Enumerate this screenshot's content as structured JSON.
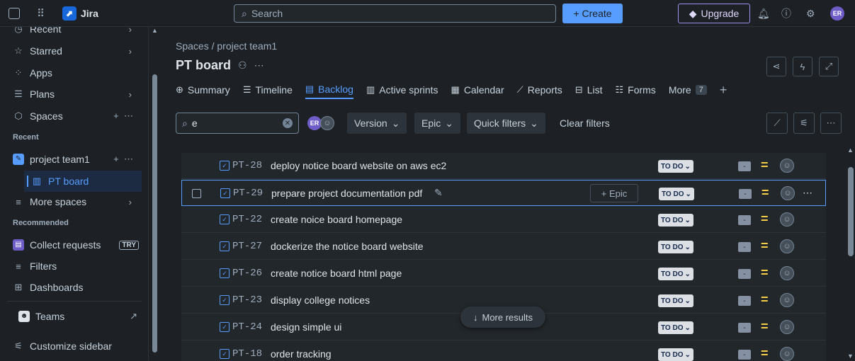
{
  "topbar": {
    "app_name": "Jira",
    "search_placeholder": "Search",
    "create_label": "+ Create",
    "upgrade_label": "Upgrade",
    "avatar_initials": "ER"
  },
  "sidebar": {
    "items": [
      {
        "label": "Recent",
        "icon": "clock-icon"
      },
      {
        "label": "Starred",
        "icon": "star-icon"
      },
      {
        "label": "Apps",
        "icon": "apps-icon"
      },
      {
        "label": "Plans",
        "icon": "plans-icon"
      },
      {
        "label": "Spaces",
        "icon": "spaces-icon"
      }
    ],
    "recent_section": "Recent",
    "project_name": "project team1",
    "board_name": "PT board",
    "more_spaces": "More spaces",
    "recommended_section": "Recommended",
    "collect_requests": "Collect requests",
    "try_badge": "TRY",
    "filters": "Filters",
    "dashboards": "Dashboards",
    "teams": "Teams",
    "customize": "Customize sidebar"
  },
  "main": {
    "breadcrumb": "Spaces  /  project team1",
    "title": "PT board",
    "tabs": [
      {
        "label": "Summary",
        "icon": "globe-icon"
      },
      {
        "label": "Timeline",
        "icon": "timeline-icon"
      },
      {
        "label": "Backlog",
        "icon": "backlog-icon",
        "active": true
      },
      {
        "label": "Active sprints",
        "icon": "board-icon"
      },
      {
        "label": "Calendar",
        "icon": "calendar-icon"
      },
      {
        "label": "Reports",
        "icon": "chart-icon"
      },
      {
        "label": "List",
        "icon": "list-icon"
      },
      {
        "label": "Forms",
        "icon": "forms-icon"
      },
      {
        "label": "More",
        "icon": null
      }
    ],
    "more_count": "7"
  },
  "filters": {
    "search_value": "e",
    "version_label": "Version",
    "epic_label": "Epic",
    "quick_filters_label": "Quick filters",
    "clear_label": "Clear filters"
  },
  "issues": [
    {
      "key": "PT-28",
      "summary": "deploy notice board website on aws ec2",
      "status": "TO DO",
      "estimate": "-"
    },
    {
      "key": "PT-29",
      "summary": "prepare project documentation pdf",
      "status": "TO DO",
      "estimate": "-",
      "epic": "+ Epic",
      "selected": true
    },
    {
      "key": "PT-22",
      "summary": "create noice board homepage",
      "status": "TO DO",
      "estimate": "-"
    },
    {
      "key": "PT-27",
      "summary": "dockerize the notice board website",
      "status": "TO DO",
      "estimate": "-"
    },
    {
      "key": "PT-26",
      "summary": "create notice board html page",
      "status": "TO DO",
      "estimate": "-"
    },
    {
      "key": "PT-23",
      "summary": "display college notices",
      "status": "TO DO",
      "estimate": "-"
    },
    {
      "key": "PT-24",
      "summary": "design simple ui",
      "status": "TO DO",
      "estimate": "-"
    },
    {
      "key": "PT-18",
      "summary": "order tracking",
      "status": "TO DO",
      "estimate": "-"
    }
  ],
  "more_results": "More results",
  "colors": {
    "accent": "#579dff",
    "priority": "#f5cd47",
    "upgrade": "#e774bb"
  }
}
